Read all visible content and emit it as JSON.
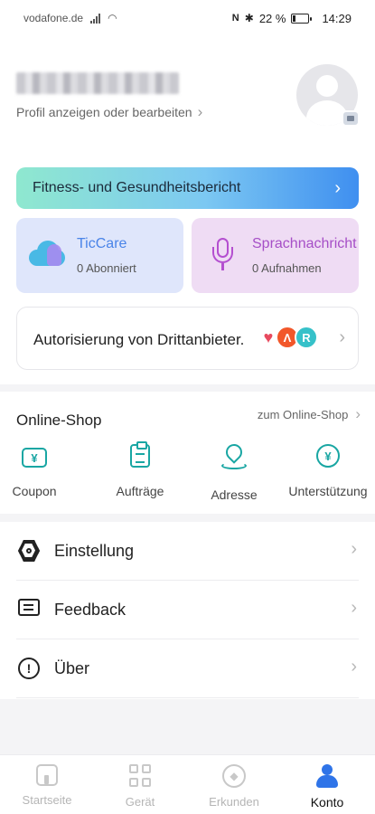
{
  "status": {
    "carrier": "vodafone.de",
    "battery_text": "22 %",
    "time": "14:29",
    "battery_level": 0.22
  },
  "profile": {
    "username": "████████████",
    "edit_link": "Profil anzeigen oder bearbeiten"
  },
  "fitness_banner": {
    "label": "Fitness- und Gesundheitsbericht"
  },
  "ticcare": {
    "title": "TicCare",
    "subtitle": "0 Abonniert"
  },
  "voice": {
    "title": "Sprachnachricht",
    "subtitle": "0 Aufnahmen"
  },
  "authorization": {
    "label": "Autorisierung von Drittanbieter."
  },
  "shop": {
    "title": "Online-Shop",
    "link": "zum Online-Shop",
    "items": [
      {
        "label": "Coupon",
        "icon": "coupon-icon"
      },
      {
        "label": "Aufträge",
        "icon": "orders-icon"
      },
      {
        "label": "Adresse",
        "icon": "address-icon"
      },
      {
        "label": "Unterstützung",
        "icon": "support-icon"
      }
    ]
  },
  "settings": {
    "items": [
      {
        "label": "Einstellung",
        "icon": "settings-icon"
      },
      {
        "label": "Feedback",
        "icon": "feedback-icon"
      },
      {
        "label": "Über",
        "icon": "info-icon"
      }
    ]
  },
  "bottom_nav": {
    "items": [
      {
        "label": "Startseite",
        "icon": "home-icon"
      },
      {
        "label": "Gerät",
        "icon": "device-icon"
      },
      {
        "label": "Erkunden",
        "icon": "compass-icon"
      },
      {
        "label": "Konto",
        "icon": "account-icon",
        "active": true
      }
    ]
  },
  "colors": {
    "accent_teal": "#19a6a3",
    "accent_blue": "#2f74e8",
    "ticcare_title": "#4a84e8",
    "voice_title": "#a64fc7"
  }
}
